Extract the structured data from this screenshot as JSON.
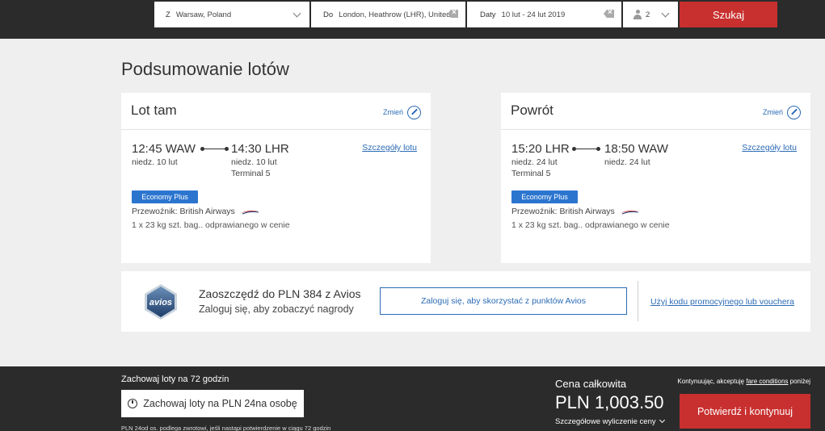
{
  "search": {
    "from_label": "Z",
    "from_value": "Warsaw, Poland",
    "to_label": "Do",
    "to_value": "London, Heathrow (LHR), United",
    "date_label": "Daty",
    "date_value": "10 lut - 24 lut 2019",
    "passengers": "2",
    "search_button": "Szukaj"
  },
  "page_title": "Podsumowanie lotów",
  "outbound": {
    "title": "Lot tam",
    "change_label": "Zmień",
    "depart_time": "12:45 WAW",
    "depart_date": "niedz. 10 lut",
    "arrive_time": "14:30 LHR",
    "arrive_date": "niedz. 10 lut",
    "arrive_terminal": "Terminal 5",
    "details_link": "Szczegóły lotu",
    "cabin": "Economy Plus",
    "carrier": "Przewoźnik: British Airways",
    "baggage": "1 x 23 kg szt. bag.. odprawianego w cenie"
  },
  "return": {
    "title": "Powrót",
    "change_label": "Zmień",
    "depart_time": "15:20 LHR",
    "depart_date": "niedz. 24 lut",
    "depart_terminal": "Terminal 5",
    "arrive_time": "18:50 WAW",
    "arrive_date": "niedz. 24 lut",
    "details_link": "Szczegóły lotu",
    "cabin": "Economy Plus",
    "carrier": "Przewoźnik: British Airways",
    "baggage": "1 x 23 kg szt. bag.. odprawianego w cenie"
  },
  "avios": {
    "logo_text": "avios",
    "title": "Zaoszczędź do PLN 384 z Avios",
    "subtitle": "Zaloguj się, aby zobaczyć nagrody",
    "login_button": "Zaloguj się, aby skorzystać z punktów Avios",
    "promo_link": "Użyj kodu promocyjnego lub vouchera"
  },
  "footer": {
    "hold_title": "Zachowaj loty na 72 godzin",
    "hold_button": "Zachowaj loty na PLN 24na osobę",
    "hold_note": "PLN 24od os. podlega zwrotowi, jeśli nastąpi potwierdzenie w ciągu 72 godzin",
    "total_label": "Cena całkowita",
    "total_value": "PLN 1,003.50",
    "price_detail": "Szczegółowe wyliczenie ceny",
    "terms_prefix": "Kontynuując, akceptuję",
    "terms_link": "fare conditions",
    "terms_suffix": "poniżej",
    "confirm_button": "Potwierdź i kontynuuj"
  },
  "colors": {
    "accent_red": "#c8302f",
    "link_blue": "#2b6bb5",
    "badge_blue": "#2b75cf",
    "dark_bar": "#2b2b2b"
  }
}
